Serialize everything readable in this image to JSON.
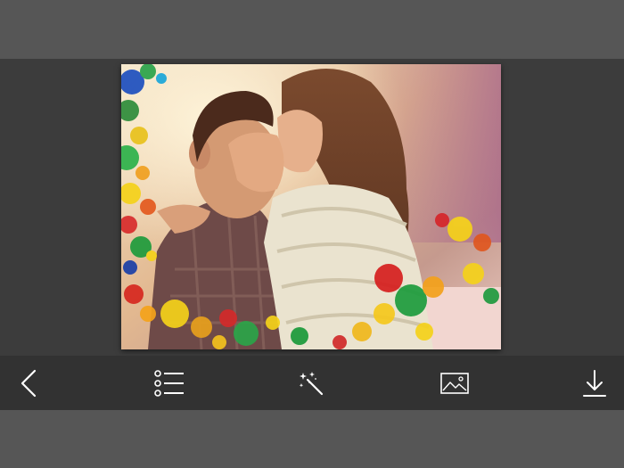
{
  "toolbar": {
    "items": [
      {
        "id": "back",
        "icon": "chevron-left-icon"
      },
      {
        "id": "menu",
        "icon": "list-icon"
      },
      {
        "id": "effects",
        "icon": "magic-wand-icon"
      },
      {
        "id": "gallery",
        "icon": "image-icon"
      },
      {
        "id": "download",
        "icon": "download-icon"
      }
    ],
    "icon_color": "#ffffff"
  },
  "colors": {
    "top_bar": "#565656",
    "canvas_background": "#3c3c3c",
    "toolbar_background": "#323232",
    "bottom_bar": "#565656"
  },
  "photo": {
    "subject": "couple-kissing-photo-with-rainbow-paint-splash-frame"
  }
}
